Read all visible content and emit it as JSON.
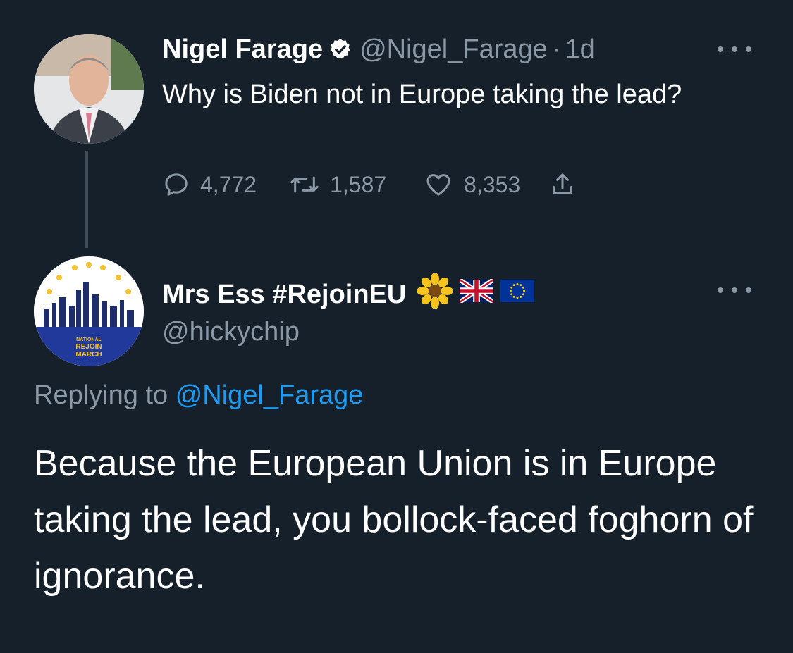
{
  "tweet": {
    "author_name": "Nigel Farage",
    "handle": "@Nigel_Farage",
    "separator": "·",
    "time": "1d",
    "text": "Why is Biden not in Europe taking the lead?",
    "stats": {
      "replies": "4,772",
      "retweets": "1,587",
      "likes": "8,353"
    },
    "icons": [
      "verified-badge-icon",
      "reply-icon",
      "retweet-icon",
      "like-icon",
      "share-icon",
      "more-icon"
    ]
  },
  "reply": {
    "author_name": "Mrs Ess #RejoinEU",
    "handle": "@hickychip",
    "name_emojis": [
      "sunflower",
      "uk-flag",
      "eu-flag"
    ],
    "avatar_text": [
      "NATIONAL",
      "REJOIN",
      "MARCH"
    ],
    "replying_prefix": "Replying to",
    "replying_to": "@Nigel_Farage",
    "text": "Because the European Union is in Europe taking the lead, you bollock-faced foghorn of ignorance."
  },
  "colors": {
    "background": "#15202b",
    "text": "#ffffff",
    "muted": "#8b98a5",
    "link": "#1d9bf0"
  }
}
